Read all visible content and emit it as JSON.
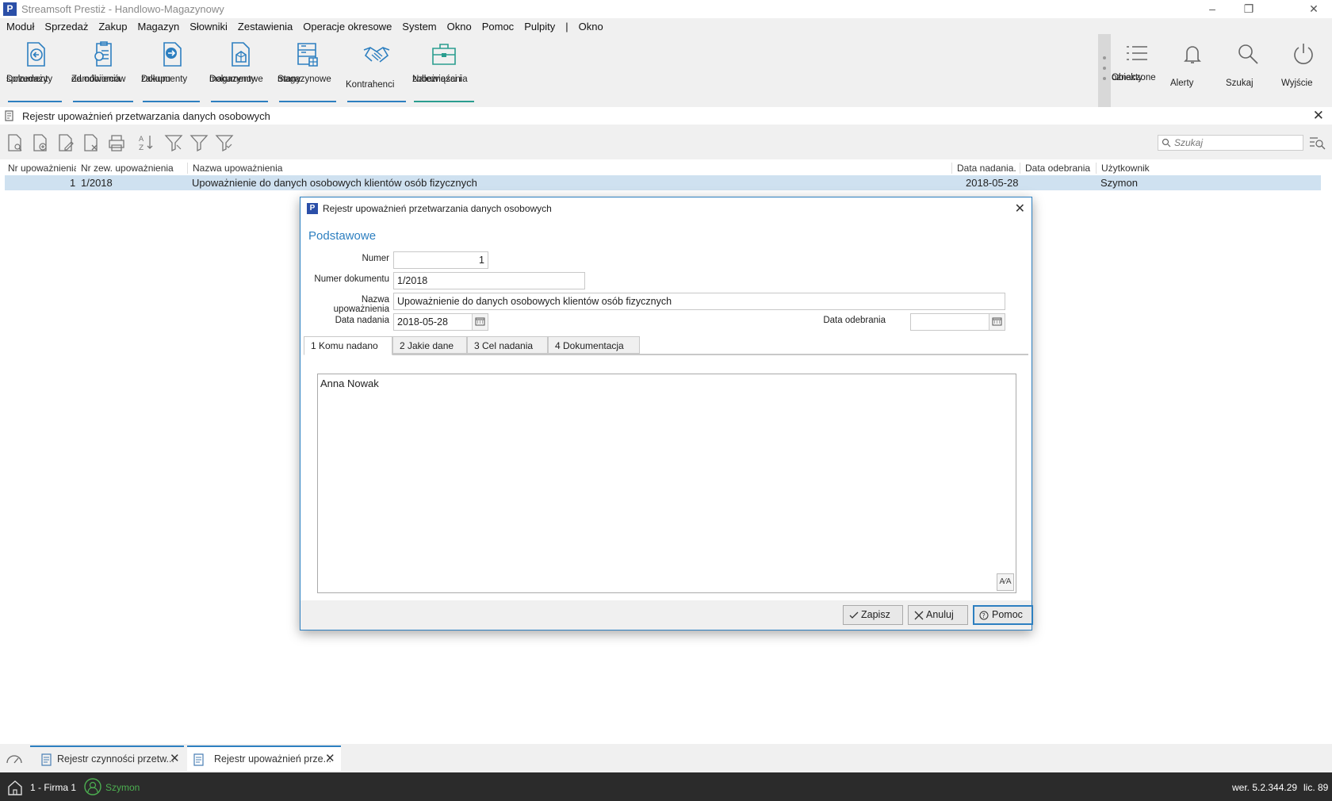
{
  "window": {
    "title": "Streamsoft Prestiż - Handlowo-Magazynowy",
    "logo_letter": "P"
  },
  "menu": [
    "Moduł",
    "Sprzedaż",
    "Zakup",
    "Magazyn",
    "Słowniki",
    "Zestawienia",
    "Operacje okresowe",
    "System",
    "Okno",
    "Pomoc",
    "Pulpity",
    "|",
    "Okno"
  ],
  "ribbon": {
    "buttons": [
      {
        "line1": "Dokumenty",
        "line2": "sprzedaży",
        "icon": "doc-arrow-left-icon"
      },
      {
        "line1": "Zamówienia",
        "line2": "od odbiorców",
        "icon": "order-list-icon"
      },
      {
        "line1": "Dokumenty",
        "line2": "zakupu",
        "icon": "doc-arrow-right-icon"
      },
      {
        "line1": "Dokumenty",
        "line2": "magazynowe",
        "icon": "doc-box-icon"
      },
      {
        "line1": "Stany",
        "line2": "magazynowe",
        "icon": "shelves-icon"
      },
      {
        "line1": "Kontrahenci",
        "line2": "",
        "icon": "handshake-icon"
      },
      {
        "line1": "Należności i",
        "line2": "zobowiązania",
        "icon": "briefcase-icon"
      }
    ],
    "right": [
      {
        "line1": "Obiekty",
        "line2": "oznaczone",
        "icon": "list-icon"
      },
      {
        "line1": "Alerty",
        "line2": "",
        "icon": "bell-icon"
      },
      {
        "line1": "Szukaj",
        "line2": "",
        "icon": "search-icon"
      },
      {
        "line1": "Wyjście",
        "line2": "",
        "icon": "power-icon"
      }
    ]
  },
  "document": {
    "title": "Rejestr upoważnień przetwarzania danych osobowych"
  },
  "search": {
    "placeholder": "Szukaj"
  },
  "grid": {
    "columns": [
      "Nr upoważnienia",
      "Nr zew. upoważnienia",
      "Nazwa upoważnienia",
      "Data nadania.",
      "Data odebrania",
      "Użytkownik"
    ],
    "rows": [
      {
        "nr": "1",
        "nr_zew": "1/2018",
        "nazwa": "Upoważnienie do danych osobowych klientów osób fizycznych",
        "data_nadania": "2018-05-28",
        "data_odebrania": "",
        "uzytkownik": "Szymon"
      }
    ]
  },
  "dialog": {
    "title": "Rejestr upoważnień przetwarzania danych osobowych",
    "section": "Podstawowe",
    "labels": {
      "numer": "Numer",
      "numer_dokumentu": "Numer dokumentu",
      "nazwa": "Nazwa upoważnienia",
      "data_nadania": "Data nadania",
      "data_odebrania": "Data odebrania"
    },
    "values": {
      "numer": "1",
      "numer_dokumentu": "1/2018",
      "nazwa": "Upoważnienie do danych osobowych klientów osób fizycznych",
      "data_nadania": "2018-05-28",
      "data_odebrania": ""
    },
    "tabs": [
      "1 Komu nadano",
      "2 Jakie dane",
      "3 Cel nadania",
      "4 Dokumentacja"
    ],
    "memo": "Anna Nowak",
    "buttons": {
      "save": "Zapisz",
      "cancel": "Anuluj",
      "help": "Pomoc"
    }
  },
  "taskbar": {
    "tabs": [
      "Rejestr czynności przetw...",
      "Rejestr upoważnień prze..."
    ]
  },
  "status": {
    "firm": "1 - Firma 1",
    "user": "Szymon",
    "version": "wer. 5.2.344.29",
    "license": "lic. 89"
  },
  "colors": {
    "accent": "#2d7fc0",
    "teal": "#2a9d8f",
    "selection": "#cfe1f0",
    "statusbar": "#2b2b2b"
  }
}
